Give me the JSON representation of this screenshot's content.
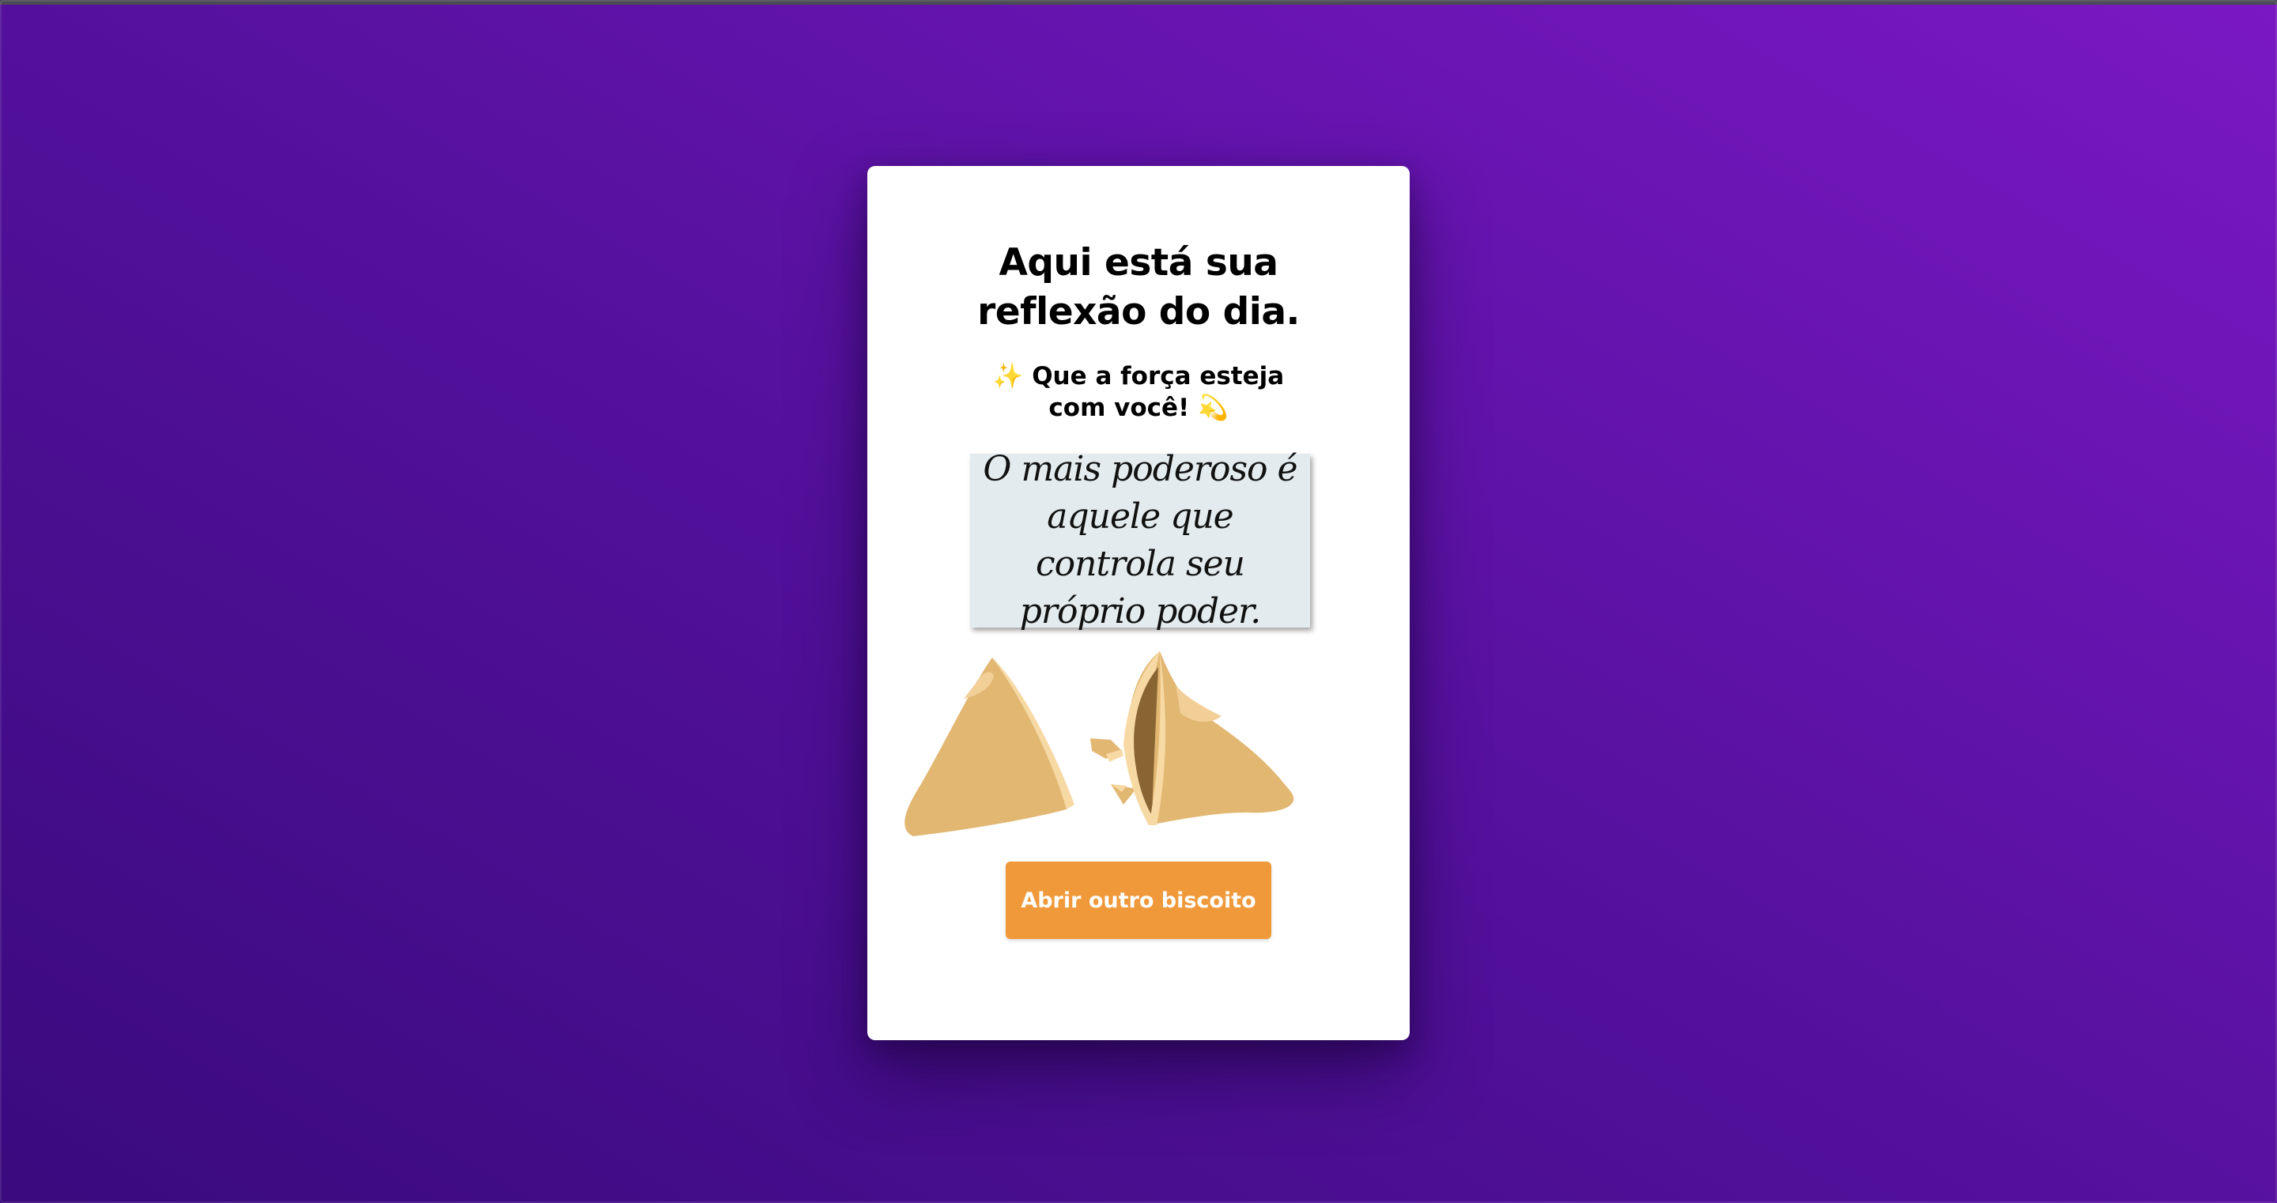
{
  "card": {
    "title": "Aqui está sua reflexão do dia.",
    "subtitle_emoji_left": "✨",
    "subtitle_text": "Que a força esteja com você!",
    "subtitle_emoji_right": "💫",
    "fortune": "O mais poderoso é aquele que controla seu próprio poder.",
    "button_label": "Abrir outro biscoito"
  },
  "colors": {
    "background_start": "#3a0a7e",
    "background_end": "#7a18c4",
    "card": "#ffffff",
    "paper": "#e3ebee",
    "button": "#f0993a",
    "cookie": "#e2b772",
    "cookie_highlight": "#f7d9a4",
    "cookie_inside": "#8a6534"
  },
  "icons": [
    "sparkles-icon",
    "dizzy-star-icon",
    "fortune-cookie-illustration"
  ]
}
